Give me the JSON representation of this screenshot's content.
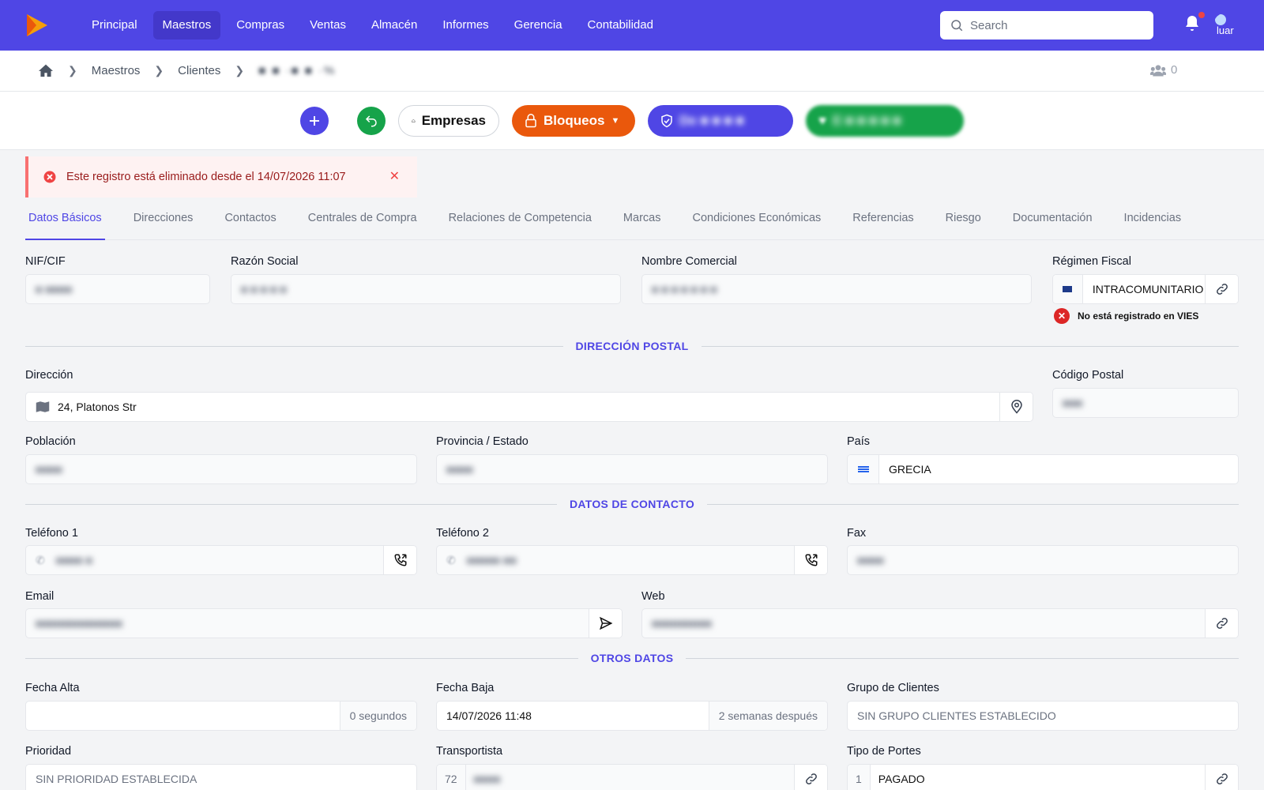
{
  "nav": {
    "items": [
      "Principal",
      "Maestros",
      "Compras",
      "Ventas",
      "Almacén",
      "Informes",
      "Gerencia",
      "Contabilidad"
    ],
    "active": "Maestros",
    "search_placeholder": "Search",
    "avatar_text": "luar"
  },
  "breadcrumb": {
    "items": [
      "Maestros",
      "Clientes"
    ],
    "current": "■ ■ ·■ ■ ·%",
    "users_count": "0"
  },
  "actions": {
    "empresas": "Empresas",
    "bloqueos": "Bloqueos",
    "indigo_blurred": "De ■ ■ ■ ■ ",
    "green_blurred": "E ■ ■ ■ ■ ■ "
  },
  "alert": {
    "text": "Este registro está eliminado desde el 14/07/2026 11:07"
  },
  "tabs": [
    "Datos Básicos",
    "Direcciones",
    "Contactos",
    "Centrales de Compra",
    "Relaciones de Competencia",
    "Marcas",
    "Condiciones Económicas",
    "Referencias",
    "Riesgo",
    "Documentación",
    "Incidencias"
  ],
  "form": {
    "nif_label": "NIF/CIF",
    "nif_value": "■ ■■■■",
    "razon_label": "Razón Social",
    "razon_value": "■ ■ ■ ■ ■",
    "nombre_label": "Nombre Comercial",
    "nombre_value": "■ ■ ■ ■ ■ ■ ■",
    "regimen_label": "Régimen Fiscal",
    "regimen_value": "INTRACOMUNITARIO",
    "vies_text": "No está registrado en VIES",
    "section_postal": "DIRECCIÓN POSTAL",
    "direccion_label": "Dirección",
    "direccion_value": "24, Platonos Str",
    "cp_label": "Código Postal",
    "cp_value": "■■■",
    "poblacion_label": "Población",
    "poblacion_value": "■■■■",
    "provincia_label": "Provincia / Estado",
    "provincia_value": "■■■■",
    "pais_label": "País",
    "pais_value": "GRECIA",
    "section_contacto": "DATOS DE CONTACTO",
    "tel1_label": "Teléfono 1",
    "tel1_value": "■■■■ ■",
    "tel2_label": "Teléfono 2",
    "tel2_value": "■■■■■ ■■",
    "fax_label": "Fax",
    "fax_value": "■■■■",
    "email_label": "Email",
    "email_value": "■■■■■■■■■■■■■",
    "web_label": "Web",
    "web_value": "■■■■■■■■■",
    "section_otros": "OTROS DATOS",
    "alta_label": "Fecha Alta",
    "alta_value": "",
    "alta_suffix": "0 segundos",
    "baja_label": "Fecha Baja",
    "baja_value": "14/07/2026 11:48",
    "baja_suffix": "2 semanas después",
    "grupo_label": "Grupo de Clientes",
    "grupo_value": "SIN GRUPO CLIENTES ESTABLECIDO",
    "prioridad_label": "Prioridad",
    "prioridad_value": "SIN PRIORIDAD ESTABLECIDA",
    "transportista_label": "Transportista",
    "transportista_code": "72",
    "transportista_value": "■■■■",
    "portes_label": "Tipo de Portes",
    "portes_code": "1",
    "portes_value": "PAGADO"
  },
  "colors": {
    "primary": "#4f46e5",
    "orange": "#ea580c",
    "green": "#16a34a",
    "danger": "#dc2626"
  }
}
